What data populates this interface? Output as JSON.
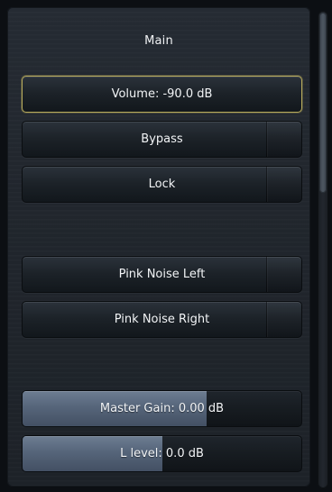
{
  "panel": {
    "title": "Main"
  },
  "buttons": {
    "volume": {
      "label": "Volume: -90.0 dB",
      "selected": true
    },
    "bypass": {
      "label": "Bypass"
    },
    "lock": {
      "label": "Lock"
    },
    "pink_noise_left": {
      "label": "Pink Noise Left"
    },
    "pink_noise_right": {
      "label": "Pink Noise Right"
    }
  },
  "faders": {
    "master_gain": {
      "label": "Master Gain: 0.00 dB",
      "level": 0.66
    },
    "l_level": {
      "label": "L level: 0.0 dB",
      "level": 0.5
    }
  },
  "colors": {
    "selection_outline": "#b8ab5c",
    "fader_fill": "#5a697e",
    "panel_bg": "#22272e"
  }
}
